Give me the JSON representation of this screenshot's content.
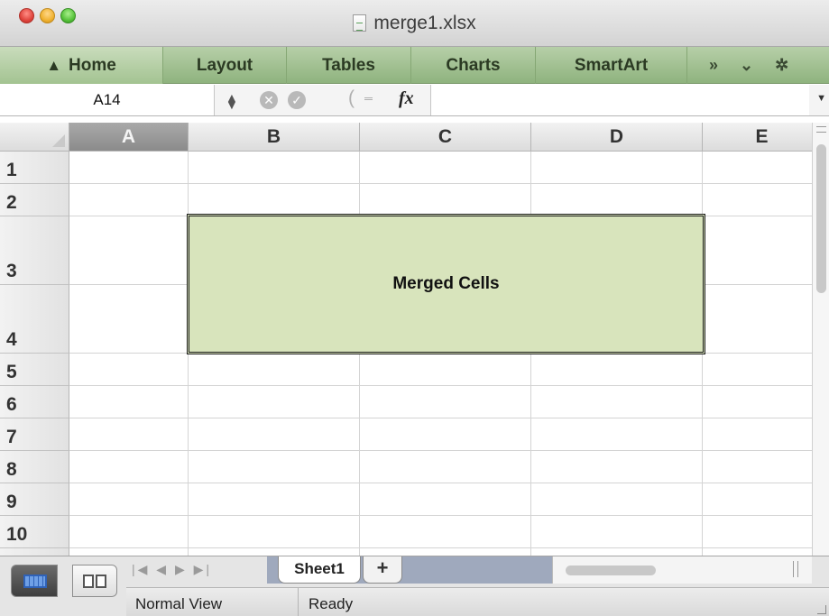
{
  "window": {
    "title": "merge1.xlsx"
  },
  "ribbon": {
    "tabs": [
      {
        "label": "Home",
        "icon": "home-icon"
      },
      {
        "label": "Layout"
      },
      {
        "label": "Tables"
      },
      {
        "label": "Charts"
      },
      {
        "label": "SmartArt"
      }
    ],
    "overflow_glyph": "»",
    "collapse_glyph": "⌄",
    "settings_glyph": "✲"
  },
  "formula_bar": {
    "name_box": "A14",
    "fx_label": "fx",
    "formula_value": ""
  },
  "grid": {
    "columns": [
      "A",
      "B",
      "C",
      "D",
      "E"
    ],
    "active_column": "A",
    "rows": [
      "1",
      "2",
      "3",
      "4",
      "5",
      "6",
      "7",
      "8",
      "9",
      "10"
    ],
    "merged_cell_text": "Merged Cells",
    "merged_fill_color": "#d8e4bc"
  },
  "sheets": {
    "tabs": [
      "Sheet1"
    ],
    "add_label": "+"
  },
  "status": {
    "view_mode": "Normal View",
    "state": "Ready"
  }
}
